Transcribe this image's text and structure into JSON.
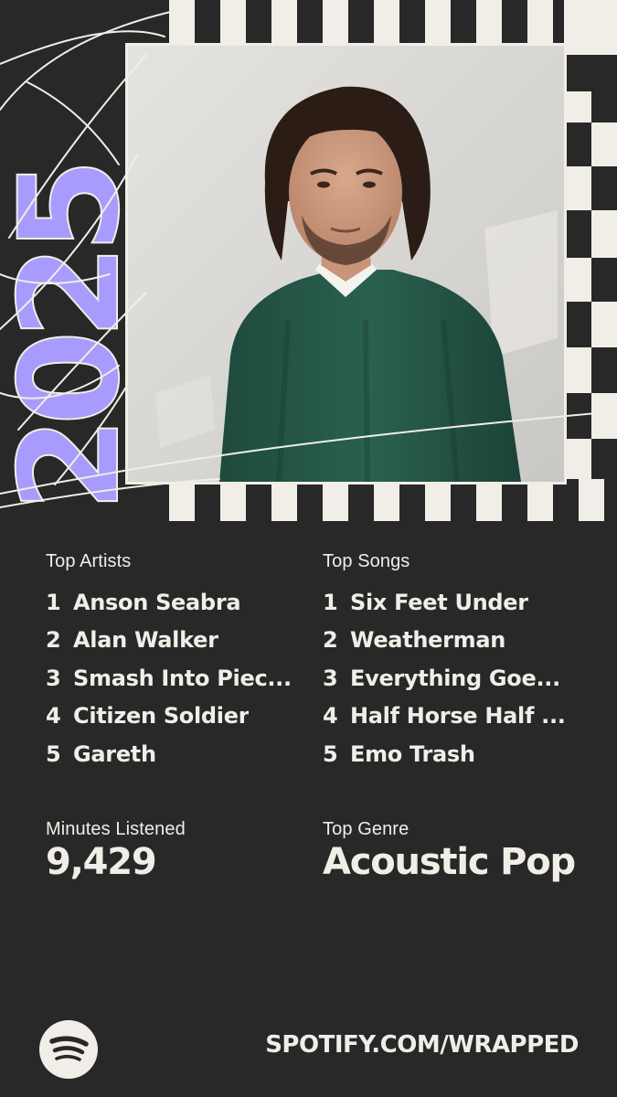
{
  "year_graphic": "2025",
  "colors": {
    "background": "#282828",
    "cream": "#f1eee7",
    "accent_purple": "#a79bfd"
  },
  "top_artists": {
    "label": "Top Artists",
    "items": [
      {
        "rank": "1",
        "name": "Anson Seabra"
      },
      {
        "rank": "2",
        "name": "Alan Walker"
      },
      {
        "rank": "3",
        "name": "Smash Into Piec..."
      },
      {
        "rank": "4",
        "name": "Citizen Soldier"
      },
      {
        "rank": "5",
        "name": "Gareth"
      }
    ]
  },
  "top_songs": {
    "label": "Top Songs",
    "items": [
      {
        "rank": "1",
        "name": "Six Feet Under"
      },
      {
        "rank": "2",
        "name": "Weatherman"
      },
      {
        "rank": "3",
        "name": "Everything Goe..."
      },
      {
        "rank": "4",
        "name": "Half Horse Half ..."
      },
      {
        "rank": "5",
        "name": "Emo Trash"
      }
    ]
  },
  "minutes": {
    "label": "Minutes Listened",
    "value": "9,429"
  },
  "genre": {
    "label": "Top Genre",
    "value": "Acoustic Pop"
  },
  "footer": {
    "logo_icon": "spotify-logo-icon",
    "url": "SPOTIFY.COM/WRAPPED"
  }
}
